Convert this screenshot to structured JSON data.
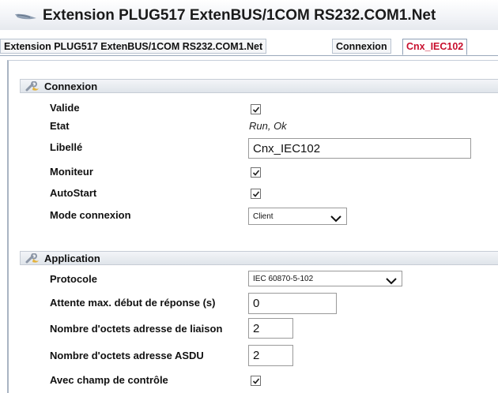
{
  "window": {
    "title": "Extension PLUG517 ExtenBUS/1COM RS232.COM1.Net"
  },
  "tabs": [
    {
      "label": "Extension PLUG517 ExtenBUS/1COM RS232.COM1.Net",
      "active": false
    },
    {
      "label": "Connexion",
      "active": false
    },
    {
      "label": "Cnx_IEC102",
      "active": true
    }
  ],
  "connexion": {
    "title": "Connexion",
    "valide_label": "Valide",
    "valide_checked": true,
    "etat_label": "Etat",
    "etat_value": "Run, Ok",
    "libelle_label": "Libellé",
    "libelle_value": "Cnx_IEC102",
    "moniteur_label": "Moniteur",
    "moniteur_checked": true,
    "autostart_label": "AutoStart",
    "autostart_checked": true,
    "mode_label": "Mode connexion",
    "mode_value": "Client"
  },
  "application": {
    "title": "Application",
    "protocole_label": "Protocole",
    "protocole_value": "IEC 60870-5-102",
    "attente_label": "Attente max. début de réponse (s)",
    "attente_value": "0",
    "octets_liaison_label": "Nombre d'octets adresse de liaison",
    "octets_liaison_value": "2",
    "octets_asdu_label": "Nombre d'octets adresse ASDU",
    "octets_asdu_value": "2",
    "champ_controle_label": "Avec champ de contrôle",
    "champ_controle_checked": true
  },
  "colors": {
    "active_tab": "#c8102e",
    "border": "#a9b4c3"
  },
  "icons": {
    "title": "brush-icon",
    "section": "wrench-icon"
  }
}
